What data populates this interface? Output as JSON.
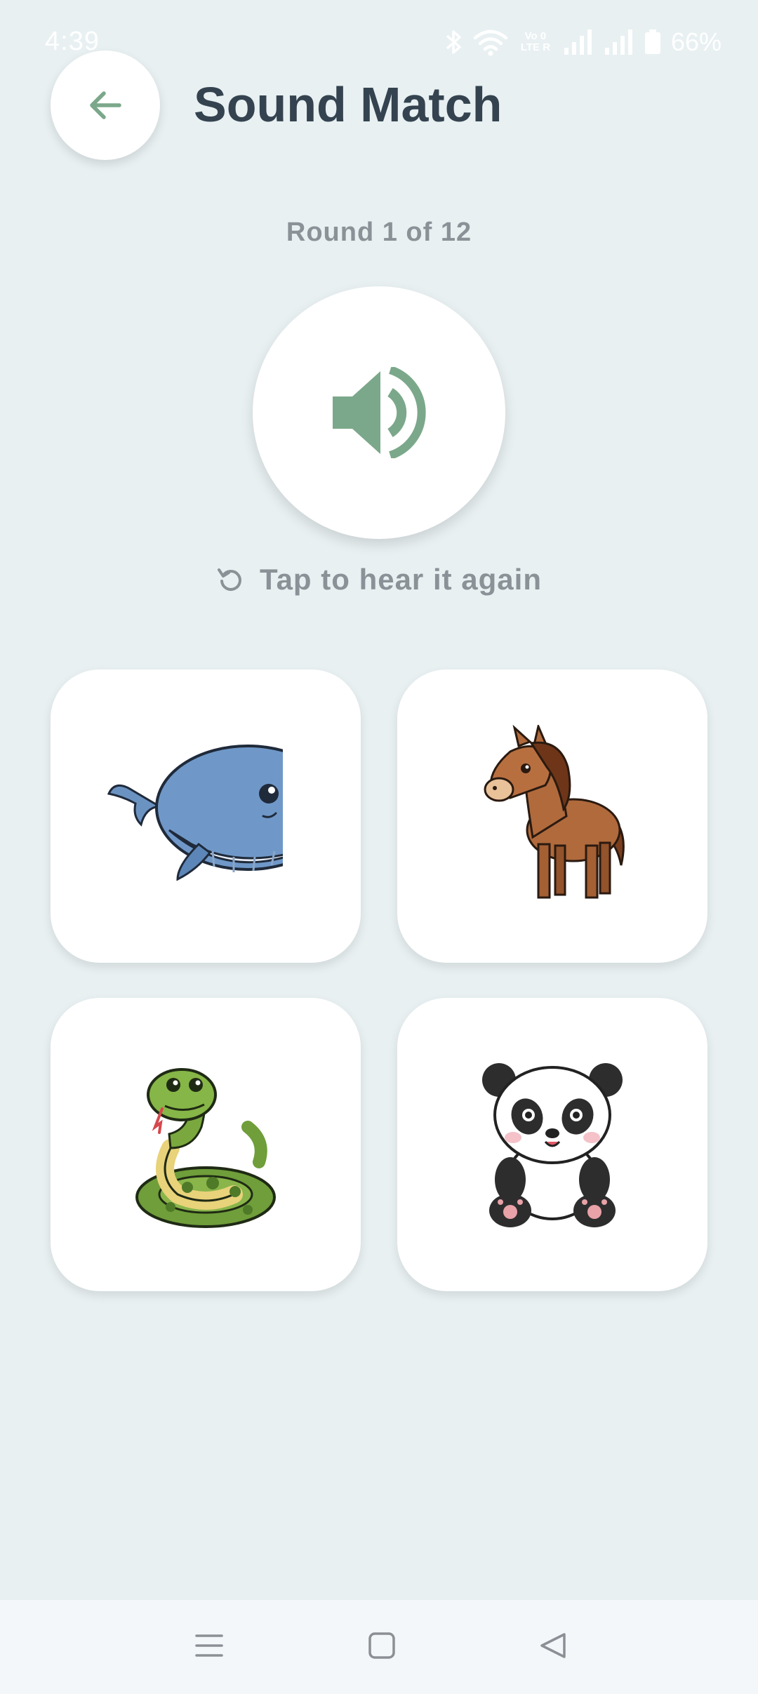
{
  "status_bar": {
    "time": "4:39",
    "volte": [
      "Vo 0",
      "LTE R"
    ],
    "battery": "66%",
    "icons": [
      "bluetooth-icon",
      "wifi-icon",
      "volte-icon",
      "signal-icon",
      "signal-icon",
      "battery-icon"
    ]
  },
  "header": {
    "title": "Sound Match",
    "back_icon": "arrow-left-icon"
  },
  "round": {
    "label": "Round 1 of 12"
  },
  "player": {
    "icon": "speaker-icon",
    "hint": "Tap to hear it again",
    "hint_icon": "replay-icon"
  },
  "options": [
    {
      "animal": "whale",
      "icon": "whale-icon"
    },
    {
      "animal": "horse",
      "icon": "horse-icon"
    },
    {
      "animal": "snake",
      "icon": "snake-icon"
    },
    {
      "animal": "panda",
      "icon": "panda-icon"
    }
  ],
  "nav": {
    "buttons": [
      "menu-icon",
      "home-icon",
      "back-icon"
    ]
  },
  "colors": {
    "background": "#e8f0f2",
    "accent": "#7ba88a",
    "title": "#34434f",
    "muted_text": "#8a9297",
    "card": "#ffffff"
  }
}
